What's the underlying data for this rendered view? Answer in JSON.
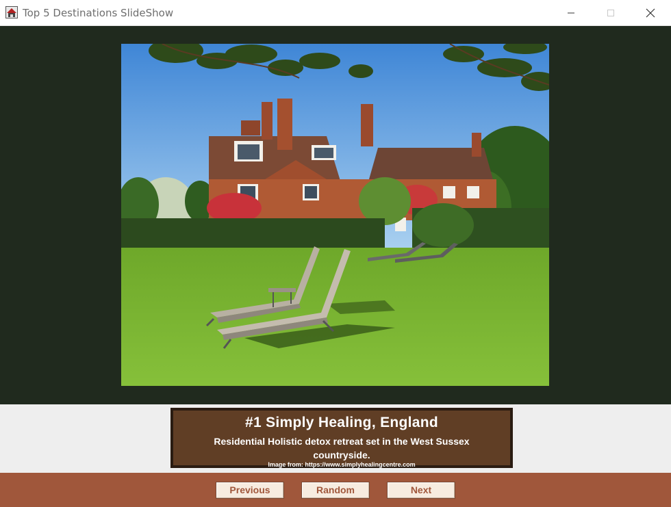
{
  "window": {
    "title": "Top 5 Destinations SlideShow",
    "controls": [
      "minimize",
      "maximize",
      "close"
    ]
  },
  "slide": {
    "image_icon": "country-house-photo",
    "title": "#1 Simply Healing, England",
    "description": "Residential Holistic detox retreat set in the West Sussex countryside.",
    "credit": "Image from: https://www.simplyhealingcentre.com"
  },
  "navigation": {
    "previous_label": "Previous",
    "random_label": "Random",
    "next_label": "Next"
  },
  "colors": {
    "image_background": "#202a1e",
    "caption_background": "#603e25",
    "nav_background": "#a0573b",
    "button_face": "#f7ece0",
    "button_text": "#a0573b"
  }
}
